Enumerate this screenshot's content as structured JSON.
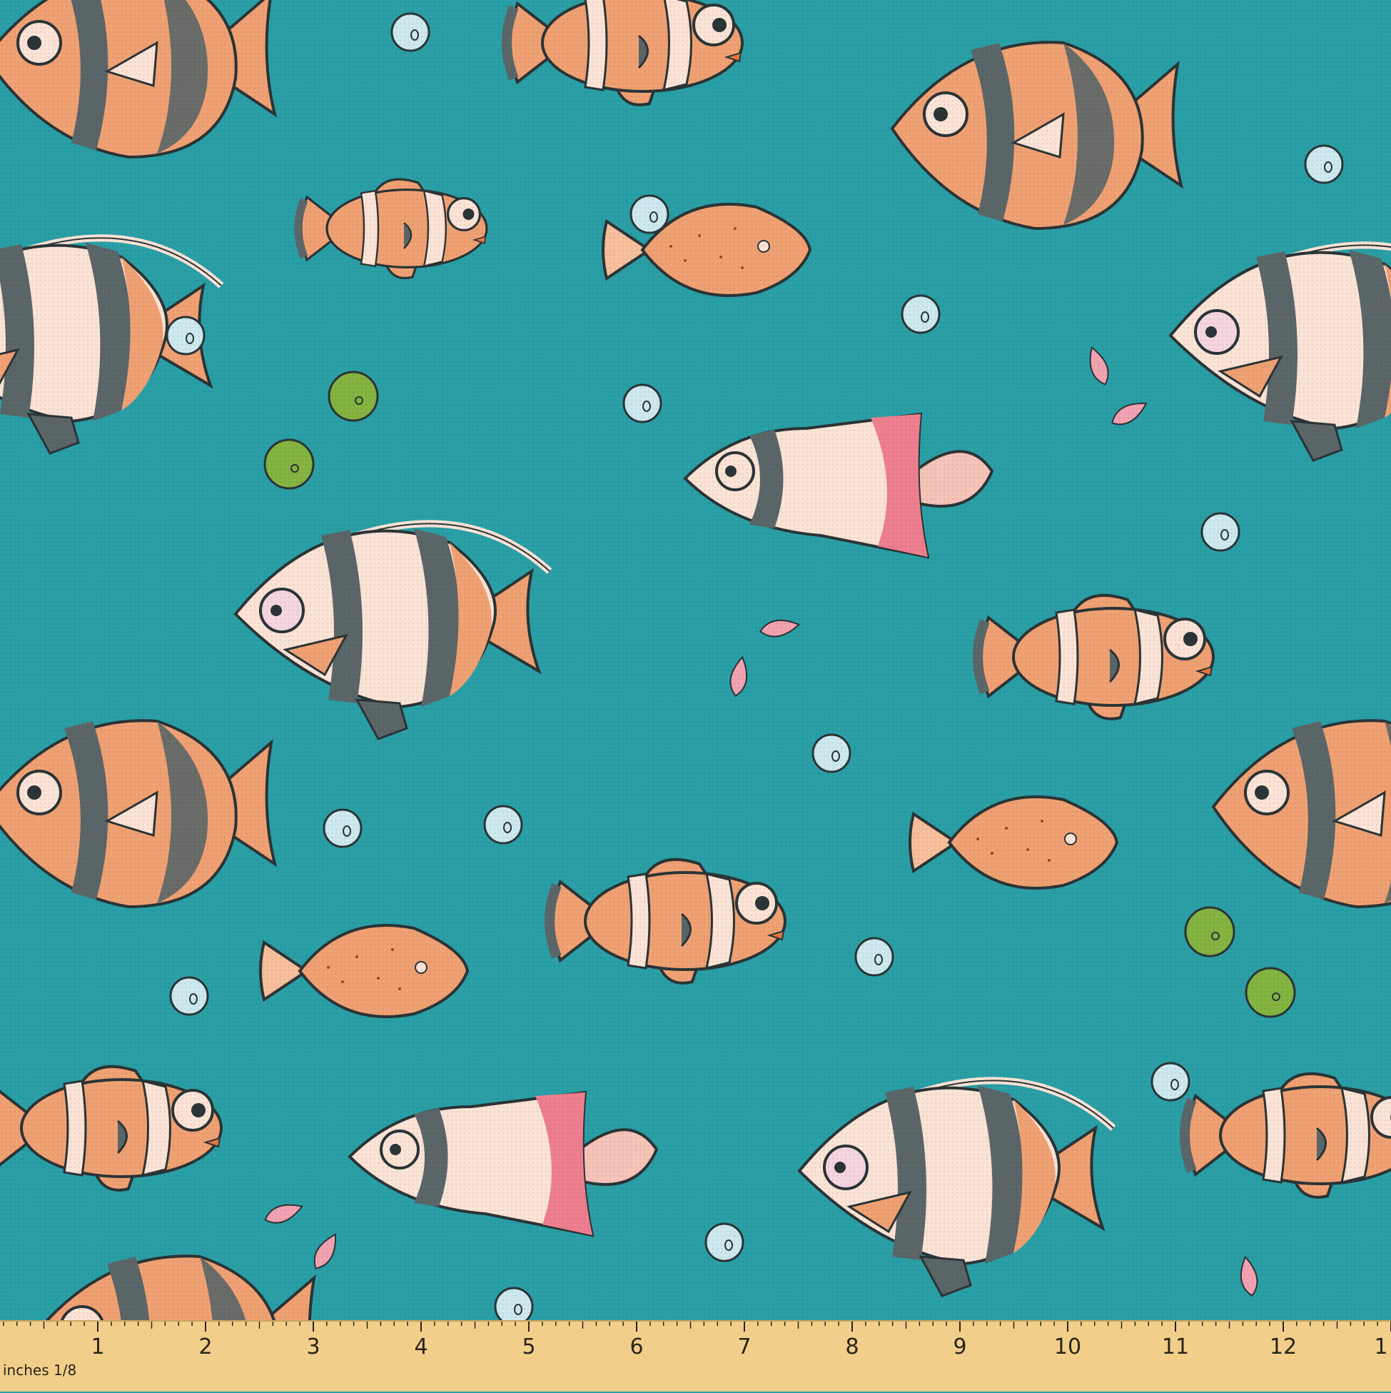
{
  "image": {
    "subject": "teal fabric swatch with cartoon tropical fish print",
    "colors": {
      "background": "#2a9fa6",
      "orange": "#f0a173",
      "cream": "#fbe3d6",
      "gray": "#5b6668",
      "pink": "#ee7f8f",
      "bubble": "#cde9ef",
      "green": "#84b441",
      "outline": "#2b3436",
      "ruler": "#f1cf8b"
    }
  },
  "ruler": {
    "unit_label": "inches 1/8",
    "numbers": [
      "1",
      "2",
      "3",
      "4",
      "5",
      "6",
      "7",
      "8",
      "9",
      "10",
      "11",
      "12",
      "1"
    ]
  }
}
